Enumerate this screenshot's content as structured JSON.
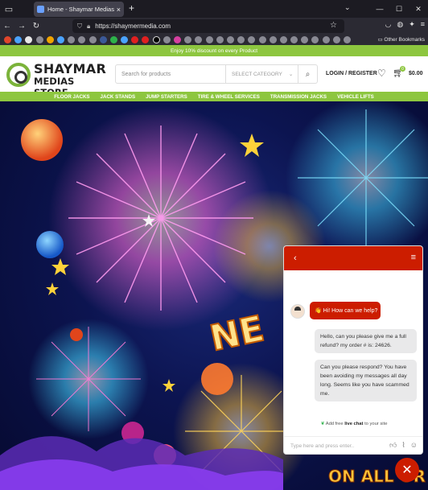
{
  "browser": {
    "tab_title": "Home - Shaymar Medias Store",
    "tab_close": "×",
    "new_tab": "+",
    "url": "https://shaymermedia.com",
    "other_bookmarks": "Other Bookmarks"
  },
  "site": {
    "promo": "Enjoy 10% discount on every Product",
    "logo_line1": "SHAYMAR",
    "logo_line2": "MEDIAS STORE",
    "search_placeholder": "Search for products",
    "category_select": "SELECT CATEGORY",
    "login": "LOGIN / REGISTER",
    "cart_count": "0",
    "cart_total": "$0.00",
    "menu": [
      "FLOOR JACKS",
      "JACK STANDS",
      "JUMP STARTERS",
      "TIRE & WHEEL SERVICES",
      "TRANSMISSION JACKS",
      "VEHICLE LIFTS"
    ]
  },
  "hero": {
    "text_partial": "NE",
    "text_bottom": "ON ALL OR"
  },
  "chat": {
    "bot_message": "👋 Hi! How can we help?",
    "user_message_1": "Hello, can you please give me a full refund? my order # is: 24626.",
    "user_message_2": "Can you please respond? You have been avoiding my messages all day long. Seems like you have scammed me.",
    "powered_prefix": "Add free ",
    "powered_bold": "live chat",
    "powered_suffix": " to your site",
    "input_placeholder": "Type here and press enter.."
  },
  "colors": {
    "brand_green": "#8dc63f",
    "chat_red": "#cc1d00"
  }
}
